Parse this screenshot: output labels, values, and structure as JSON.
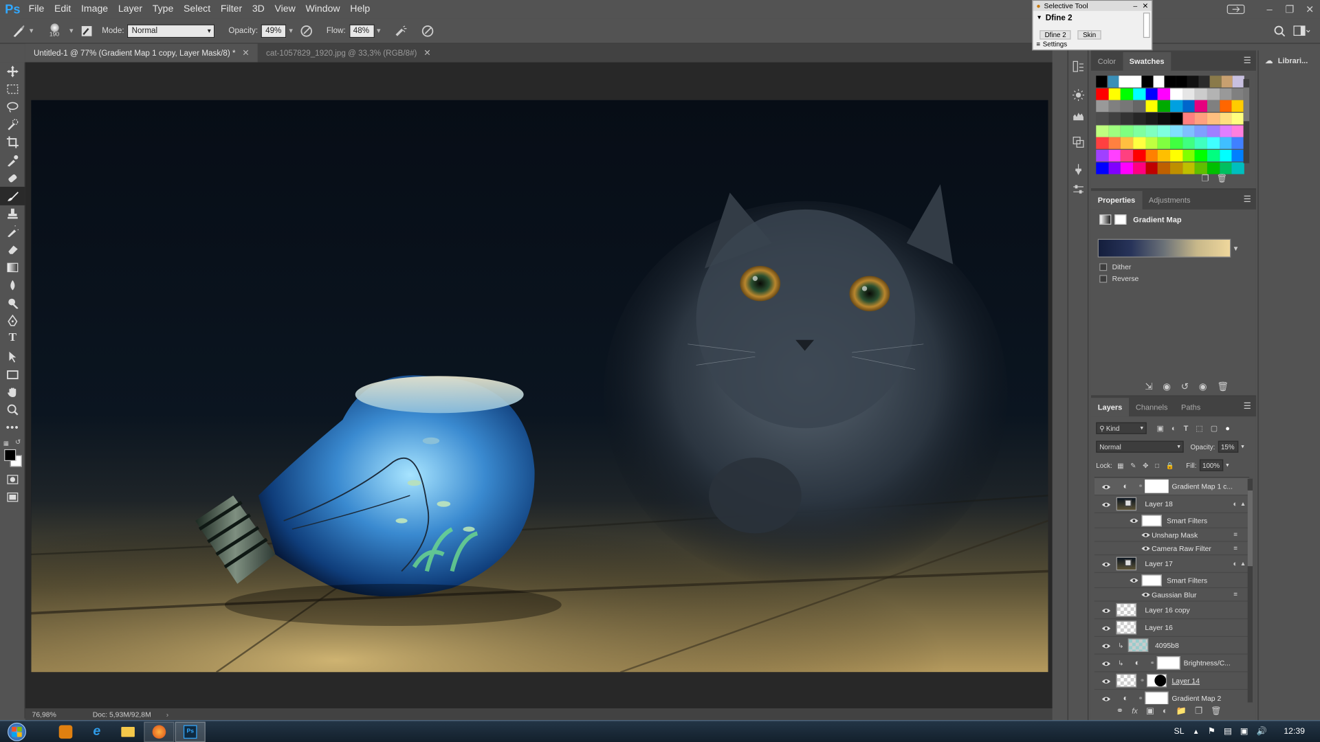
{
  "app": {
    "logo": "Ps"
  },
  "menu": [
    "File",
    "Edit",
    "Image",
    "Layer",
    "Type",
    "Select",
    "Filter",
    "3D",
    "View",
    "Window",
    "Help"
  ],
  "options": {
    "brush_size": "190",
    "mode_label": "Mode:",
    "mode_value": "Normal",
    "opacity_label": "Opacity:",
    "opacity_value": "49%",
    "flow_label": "Flow:",
    "flow_value": "48%"
  },
  "tabs": [
    {
      "label": "Untitled-1 @ 77% (Gradient Map 1 copy, Layer Mask/8) *",
      "active": true
    },
    {
      "label": "cat-1057829_1920.jpg @ 33,3% (RGB/8#)",
      "active": false
    }
  ],
  "status": {
    "zoom": "76,98%",
    "doc": "Doc: 5,93M/92,8M"
  },
  "selective_tool": {
    "title": "Selective Tool",
    "heading": "Dfine 2",
    "button_1": "Dfine 2",
    "button_2": "Skin",
    "settings": "Settings"
  },
  "color_panel": {
    "tab_color": "Color",
    "tab_swatches": "Swatches"
  },
  "swatches": [
    [
      "#000000",
      "#3a8fb7",
      "#ffffff",
      "#ffffff",
      "#000000",
      "#ffffff",
      "#000000",
      "#000000",
      "#111111",
      "#2b2b2b",
      "#8a7a4a",
      "#c8a070",
      "#c8c0e0"
    ],
    [
      "#ff0000",
      "#ffff00",
      "#00ff00",
      "#00ffff",
      "#0000ff",
      "#ff00ff",
      "#ffffff",
      "#e6e6e6",
      "#cccccc",
      "#b3b3b3",
      "#999999",
      "#808080"
    ],
    [
      "#999999",
      "#808080",
      "#777777",
      "#666666",
      "#ffff00",
      "#00aa00",
      "#00a0e0",
      "#0066cc",
      "#e6007e",
      "#808080",
      "#ff6600",
      "#ffcc00"
    ],
    [
      "#4d4d4d",
      "#404040",
      "#333333",
      "#262626",
      "#1a1a1a",
      "#0d0d0d",
      "#000000",
      "#ff7f7f",
      "#ff9f7f",
      "#ffbf7f",
      "#ffdf7f",
      "#ffff7f"
    ],
    [
      "#bfff7f",
      "#9fff7f",
      "#7fff7f",
      "#7fff9f",
      "#7fffbf",
      "#7fffdf",
      "#7fdfff",
      "#7fbfff",
      "#7f9fff",
      "#9f7fff",
      "#df7fff",
      "#ff7fdf"
    ],
    [
      "#ff4040",
      "#ff8040",
      "#ffbf40",
      "#ffff40",
      "#bfff40",
      "#80ff40",
      "#40ff40",
      "#40ff80",
      "#40ffbf",
      "#40ffff",
      "#40bfff",
      "#4080ff"
    ],
    [
      "#a040ff",
      "#ff40ff",
      "#ff4080",
      "#ff0000",
      "#ff8000",
      "#ffbf00",
      "#ffff00",
      "#80ff00",
      "#00ff00",
      "#00ff80",
      "#00ffff",
      "#0080ff"
    ],
    [
      "#0000ff",
      "#8000ff",
      "#ff00ff",
      "#ff0080",
      "#bf0000",
      "#bf6000",
      "#bf8f00",
      "#bfbf00",
      "#60bf00",
      "#00bf00",
      "#00bf60",
      "#00bfbf"
    ]
  ],
  "properties": {
    "tab_properties": "Properties",
    "tab_adjustments": "Adjustments",
    "title": "Gradient Map",
    "dither": "Dither",
    "reverse": "Reverse"
  },
  "layers_panel": {
    "tab_layers": "Layers",
    "tab_channels": "Channels",
    "tab_paths": "Paths",
    "kind": "Kind",
    "blend_mode": "Normal",
    "opacity_label": "Opacity:",
    "opacity_value": "15%",
    "lock_label": "Lock:",
    "fill_label": "Fill:",
    "fill_value": "100%",
    "layers": [
      {
        "name": "Gradient Map 1 c...",
        "type": "adjustment",
        "mask": true
      },
      {
        "name": "Layer 18",
        "type": "smart"
      },
      {
        "name": "Smart Filters",
        "type": "smartfilters"
      },
      {
        "name": "Unsharp Mask",
        "type": "filter"
      },
      {
        "name": "Camera Raw Filter",
        "type": "filter"
      },
      {
        "name": "Layer 17",
        "type": "smart"
      },
      {
        "name": "Smart Filters",
        "type": "smartfilters"
      },
      {
        "name": "Gaussian Blur",
        "type": "filter"
      },
      {
        "name": "Layer 16 copy",
        "type": "transparent"
      },
      {
        "name": "Layer 16",
        "type": "transparent"
      },
      {
        "name": "4095b8",
        "type": "clipped"
      },
      {
        "name": "Brightness/C...",
        "type": "adjustment-clipped"
      },
      {
        "name": "Layer 14",
        "type": "masked"
      },
      {
        "name": "Gradient Map 2",
        "type": "adjustment",
        "mask": true
      }
    ]
  },
  "libraries": {
    "label": "Librari..."
  },
  "taskbar": {
    "lang": "SL",
    "time": "12:39"
  }
}
